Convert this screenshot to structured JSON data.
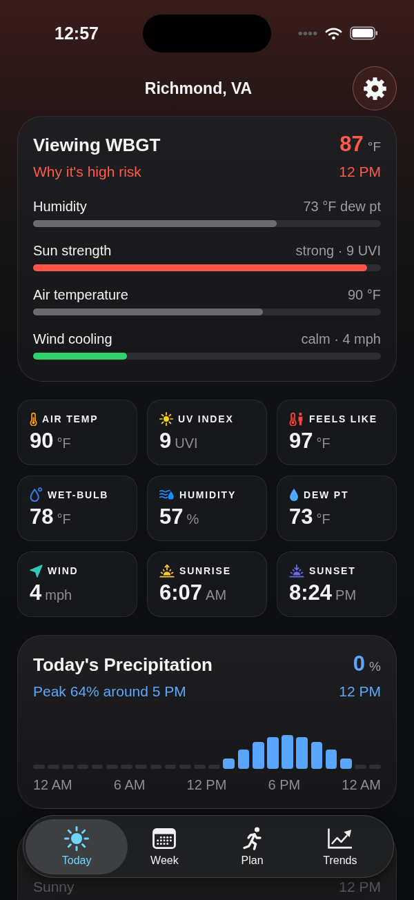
{
  "status_bar": {
    "time": "12:57"
  },
  "header": {
    "location": "Richmond, VA"
  },
  "wbgt": {
    "title": "Viewing WBGT",
    "value": "87",
    "unit": "°F",
    "subtitle": "Why it's high risk",
    "time": "12 PM",
    "factors": [
      {
        "label": "Humidity",
        "reading": "73 °F dew pt",
        "level": 0.7,
        "color": "#6b6c71"
      },
      {
        "label": "Sun strength",
        "reading": "strong · 9 UVI",
        "level": 0.96,
        "color": "#ff5447"
      },
      {
        "label": "Air temperature",
        "reading": "90 °F",
        "level": 0.66,
        "color": "#6b6c71"
      },
      {
        "label": "Wind cooling",
        "reading": "calm · 4 mph",
        "level": 0.27,
        "color": "#30d16b"
      }
    ]
  },
  "tiles": [
    {
      "label": "AIR TEMP",
      "value": "90",
      "unit": "°F"
    },
    {
      "label": "UV INDEX",
      "value": "9",
      "unit": "UVI"
    },
    {
      "label": "FEELS LIKE",
      "value": "97",
      "unit": "°F"
    },
    {
      "label": "WET-BULB",
      "value": "78",
      "unit": "°F"
    },
    {
      "label": "HUMIDITY",
      "value": "57",
      "unit": "%"
    },
    {
      "label": "DEW PT",
      "value": "73",
      "unit": "°F"
    },
    {
      "label": "WIND",
      "value": "4",
      "unit": "mph"
    },
    {
      "label": "SUNRISE",
      "value": "6:07",
      "unit": "AM"
    },
    {
      "label": "SUNSET",
      "value": "8:24",
      "unit": "PM"
    }
  ],
  "precipitation": {
    "title": "Today's Precipitation",
    "value": "0",
    "unit": "%",
    "peak": "Peak 64% around 5 PM",
    "time": "12 PM",
    "axis_labels": [
      "12 AM",
      "6 AM",
      "12 PM",
      "6 PM",
      "12 AM"
    ]
  },
  "conditions": {
    "summary": "Sunny",
    "time": "12 PM"
  },
  "tabs": [
    {
      "label": "Today",
      "selected": true
    },
    {
      "label": "Week",
      "selected": false
    },
    {
      "label": "Plan",
      "selected": false
    },
    {
      "label": "Trends",
      "selected": false
    }
  ]
}
